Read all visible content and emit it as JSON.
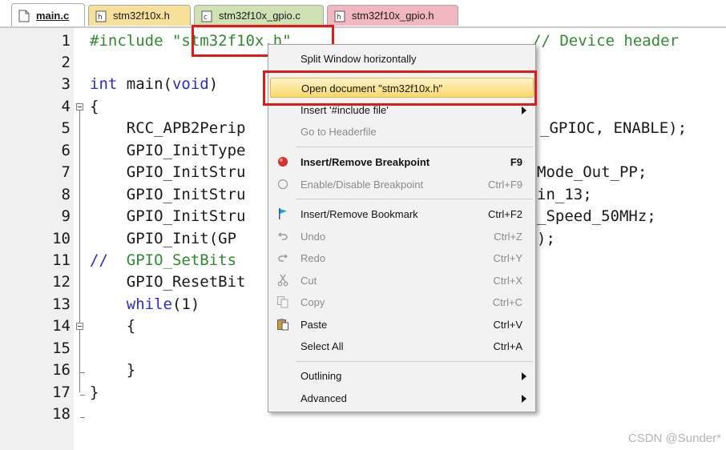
{
  "tabs": [
    {
      "label": "main.c",
      "icon": "c-file-icon"
    },
    {
      "label": "stm32f10x.h",
      "icon": "header-file-icon"
    },
    {
      "label": "stm32f10x_gpio.c",
      "icon": "c-file-icon"
    },
    {
      "label": "stm32f10x_gpio.h",
      "icon": "header-file-icon"
    }
  ],
  "code": {
    "line_numbers": [
      "1",
      "2",
      "3",
      "4",
      "5",
      "6",
      "7",
      "8",
      "9",
      "10",
      "11",
      "12",
      "13",
      "14",
      "15",
      "16",
      "17",
      "18"
    ],
    "l1_directive": "#include ",
    "l1_file": "\"stm32f10x.h\"",
    "l1_comment": "// Device header",
    "l3_kw1": "int",
    "l3_rest": " main(",
    "l3_kw2": "void",
    "l3_end": ")",
    "l4": "{",
    "l5": "    RCC_APB2Perip",
    "l5_right": "_GPIOC, ENABLE);",
    "l6": "    GPIO_InitType",
    "l7": "    GPIO_InitStru",
    "l7_right": "Mode_Out_PP;",
    "l8": "    GPIO_InitStru",
    "l8_right": "in_13;",
    "l9": "    GPIO_InitStru",
    "l9_right": "_Speed_50MHz;",
    "l10": "    GPIO_Init(GP",
    "l10_right": ");",
    "l11_comment": "//  ",
    "l11_code": "GPIO_SetBits",
    "l12": "    GPIO_ResetBit",
    "l13_indent": "    ",
    "l13_kw": "while",
    "l13_rest": "(1)",
    "l14": "    {",
    "l16": "    }",
    "l17": "}"
  },
  "context_menu": {
    "items": [
      {
        "label": "Split Window horizontally",
        "shortcut": "",
        "state": "normal"
      },
      {
        "label": "Open document \"stm32f10x.h\"",
        "shortcut": "",
        "state": "highlighted"
      },
      {
        "label": "Insert '#include file'",
        "shortcut": "",
        "state": "submenu"
      },
      {
        "label": "Go to Headerfile",
        "shortcut": "",
        "state": "disabled"
      },
      {
        "label": "Insert/Remove Breakpoint",
        "shortcut": "F9",
        "state": "bold",
        "icon": "breakpoint-icon"
      },
      {
        "label": "Enable/Disable Breakpoint",
        "shortcut": "Ctrl+F9",
        "state": "disabled",
        "icon": "breakpoint-outline-icon"
      },
      {
        "label": "Insert/Remove Bookmark",
        "shortcut": "Ctrl+F2",
        "state": "normal",
        "icon": "bookmark-flag-icon"
      },
      {
        "label": "Undo",
        "shortcut": "Ctrl+Z",
        "state": "disabled",
        "icon": "undo-icon"
      },
      {
        "label": "Redo",
        "shortcut": "Ctrl+Y",
        "state": "disabled",
        "icon": "redo-icon"
      },
      {
        "label": "Cut",
        "shortcut": "Ctrl+X",
        "state": "disabled",
        "icon": "scissors-icon"
      },
      {
        "label": "Copy",
        "shortcut": "Ctrl+C",
        "state": "disabled",
        "icon": "copy-icon"
      },
      {
        "label": "Paste",
        "shortcut": "Ctrl+V",
        "state": "normal",
        "icon": "paste-icon"
      },
      {
        "label": "Select All",
        "shortcut": "Ctrl+A",
        "state": "normal"
      },
      {
        "label": "Outlining",
        "shortcut": "",
        "state": "submenu"
      },
      {
        "label": "Advanced",
        "shortcut": "",
        "state": "submenu"
      }
    ]
  },
  "watermark": "CSDN @Sunder*",
  "colors": {
    "keyword": "#2b2bd6",
    "comment": "#2e8b2e",
    "highlight_box": "#e01919",
    "menu_highlight": "#f9d86a"
  }
}
